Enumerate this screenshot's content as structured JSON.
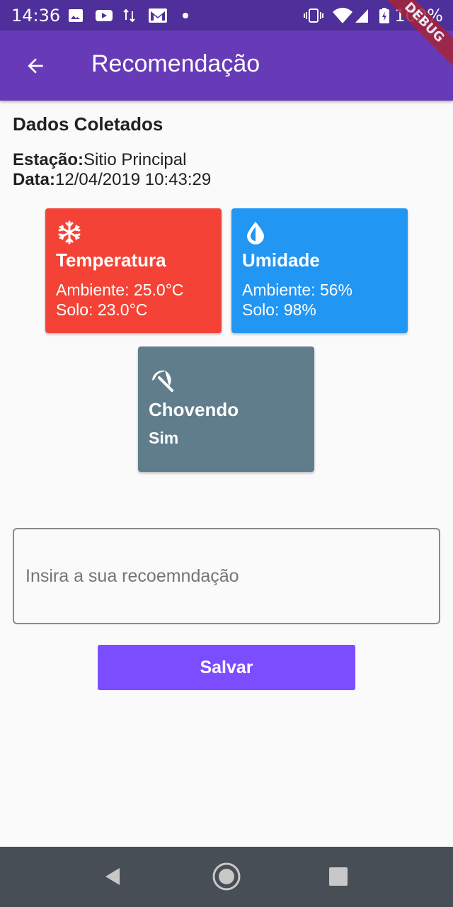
{
  "status_bar": {
    "time": "14:36",
    "battery_percent": "100%",
    "left_icons": [
      "image-icon",
      "youtube-icon",
      "data-transfer-icon",
      "gmail-icon",
      "dot-icon"
    ],
    "right_icons": [
      "vibrate-icon",
      "wifi-icon",
      "signal-icon",
      "battery-charging-icon"
    ]
  },
  "app_bar": {
    "title": "Recomendação",
    "back_icon": "arrow-back-icon",
    "background": "#673ab7"
  },
  "debug_banner": "DEBUG",
  "content": {
    "section_title": "Dados Coletados",
    "station_label": "Estação:",
    "station_value": "Sitio Principal",
    "date_label": "Data:",
    "date_value": "12/04/2019 10:43:29"
  },
  "cards": {
    "temperature": {
      "icon": "snowflake-icon",
      "title": "Temperatura",
      "line1": "Ambiente: 25.0°C",
      "line2": "Solo: 23.0°C",
      "color": "#f44336"
    },
    "humidity": {
      "icon": "water-drop-icon",
      "title": "Umidade",
      "line1": "Ambiente: 56%",
      "line2": "Solo: 98%",
      "color": "#2196f3"
    },
    "rain": {
      "icon": "umbrella-beach-icon",
      "title": "Chovendo",
      "value": "Sim",
      "color": "#607d8b"
    }
  },
  "form": {
    "recommendation_placeholder": "Insira a sua recoemndação",
    "recommendation_value": "",
    "save_label": "Salvar",
    "save_color": "#7c4dff"
  },
  "nav_bar": {
    "items": [
      "back-triangle-icon",
      "home-circle-icon",
      "recents-square-icon"
    ]
  }
}
